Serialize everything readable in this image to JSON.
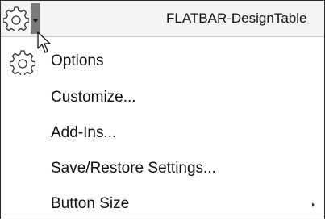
{
  "toolbar": {
    "gear_icon": "gear-icon",
    "dropdown_icon": "chevron-down-icon",
    "document_title": "FLATBAR-DesignTable"
  },
  "menu": {
    "items": [
      {
        "label": "Options",
        "icon": "gear-icon"
      },
      {
        "label": "Customize..."
      },
      {
        "label": "Add-Ins..."
      },
      {
        "label": "Save/Restore Settings..."
      },
      {
        "label": "Button Size",
        "has_submenu": true
      }
    ]
  }
}
